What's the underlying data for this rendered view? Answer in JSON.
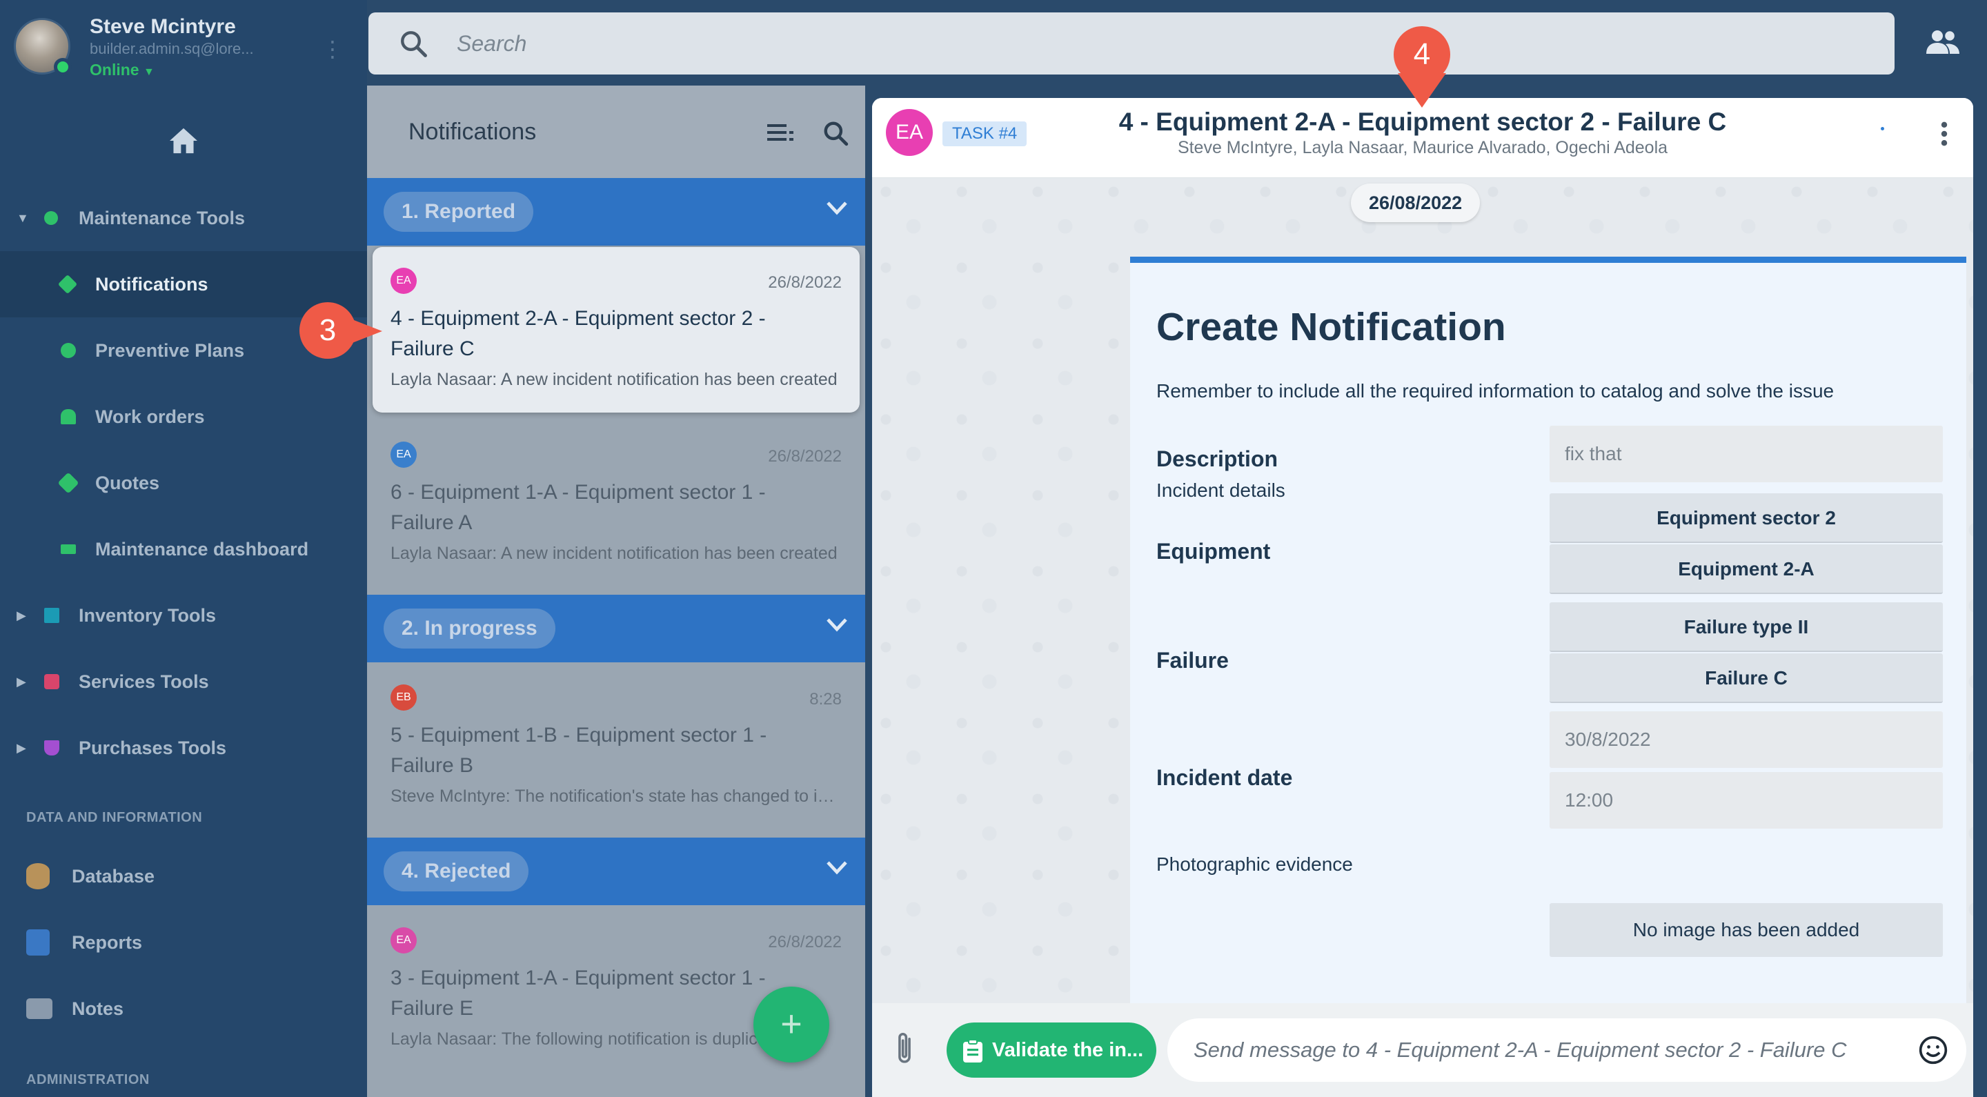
{
  "user": {
    "name": "Steve Mcintyre",
    "email": "builder.admin.sq@lore...",
    "status": "Online"
  },
  "sidebar": {
    "groups": [
      {
        "label": "Maintenance Tools",
        "color": "#2fc16a"
      },
      {
        "label": "Inventory Tools",
        "color": "#1b9bb5"
      },
      {
        "label": "Services Tools",
        "color": "#d9456b"
      },
      {
        "label": "Purchases Tools",
        "color": "#a44fd1"
      }
    ],
    "maintenance_items": [
      {
        "label": "Notifications",
        "color": "#2fc16a"
      },
      {
        "label": "Preventive Plans",
        "color": "#2fc16a"
      },
      {
        "label": "Work orders",
        "color": "#2fc16a"
      },
      {
        "label": "Quotes",
        "color": "#2fc16a"
      },
      {
        "label": "Maintenance dashboard",
        "color": "#2fc16a"
      }
    ],
    "section_data": "DATA AND INFORMATION",
    "data_items": [
      "Database",
      "Reports",
      "Notes"
    ],
    "section_admin": "ADMINISTRATION"
  },
  "search": {
    "placeholder": "Search"
  },
  "notifications": {
    "title": "Notifications",
    "groups": {
      "reported": "1. Reported",
      "in_progress": "2. In progress",
      "rejected": "4. Rejected"
    },
    "cards": [
      {
        "badge": "EA",
        "badge_color": "#e83fb2",
        "date": "26/8/2022",
        "title": "4 - Equipment 2-A - Equipment sector 2 - Failure C",
        "preview": "Layla Nasaar: A new incident notification has been created"
      },
      {
        "badge": "EA",
        "badge_color": "#2f7ed4",
        "date": "26/8/2022",
        "title": "6 - Equipment 1-A - Equipment sector 1 - Failure A",
        "preview": "Layla Nasaar: A new incident notification has been created"
      },
      {
        "badge": "EB",
        "badge_color": "#e0453a",
        "date": "8:28",
        "title": "5 - Equipment 1-B - Equipment sector 1 - Failure B",
        "preview": "Steve McIntyre: The notification's state has changed to in progress"
      },
      {
        "badge": "EA",
        "badge_color": "#e83fb2",
        "date": "26/8/2022",
        "title": "3 - Equipment 1-A - Equipment sector 1 - Failure E",
        "preview": "Layla Nasaar: The following notification is duplicated"
      }
    ]
  },
  "chat": {
    "avatar": "EA",
    "task": "TASK #4",
    "title": "4 - Equipment 2-A - Equipment sector 2 - Failure C",
    "participants": "Steve McIntyre, Layla Nasaar, Maurice Alvarado, Ogechi Adeola",
    "date_chip": "26/08/2022",
    "form": {
      "title": "Create Notification",
      "hint": "Remember to include all the required information to catalog and solve the issue",
      "description_label": "Description",
      "description_value": "fix that",
      "incident_details": "Incident details",
      "equipment_label": "Equipment",
      "equipment_sector": "Equipment sector 2",
      "equipment": "Equipment 2-A",
      "failure_label": "Failure",
      "failure_type": "Failure type II",
      "failure": "Failure C",
      "incident_date_label": "Incident date",
      "incident_date": "30/8/2022",
      "incident_time": "12:00",
      "photo_label": "Photographic evidence",
      "no_image": "No image has been added"
    },
    "validate_label": "Validate the in...",
    "message_placeholder": "Send message to 4 - Equipment 2-A - Equipment sector 2 - Failure C"
  },
  "callouts": {
    "left": "3",
    "top": "4"
  }
}
